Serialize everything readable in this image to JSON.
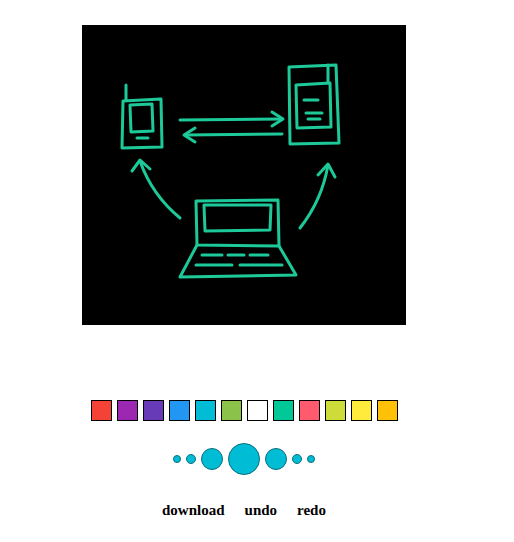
{
  "palette": [
    {
      "color": "#f44336"
    },
    {
      "color": "#9c27b0"
    },
    {
      "color": "#673ab7"
    },
    {
      "color": "#2196f3"
    },
    {
      "color": "#00bcd4"
    },
    {
      "color": "#8bc34a"
    },
    {
      "color": "#ffffff"
    },
    {
      "color": "#00c896"
    },
    {
      "color": "#ff5a6e"
    },
    {
      "color": "#cddc39"
    },
    {
      "color": "#ffeb3b"
    },
    {
      "color": "#ffc107"
    }
  ],
  "brushes": [
    {
      "level": 0.25
    },
    {
      "level": 0.31
    },
    {
      "level": 0.69
    },
    {
      "level": 1
    },
    {
      "level": 0.69
    },
    {
      "level": 0.31
    },
    {
      "level": 0.25
    }
  ],
  "buttons": [
    "download",
    "undo",
    "redo"
  ]
}
